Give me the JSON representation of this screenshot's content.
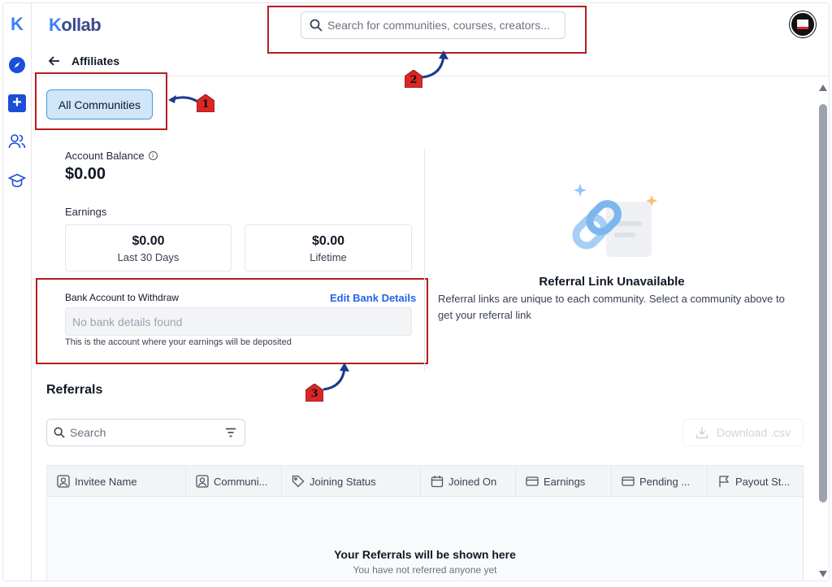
{
  "brand": {
    "logo_letter": "K",
    "name_prefix": "K",
    "name_rest": "ollab"
  },
  "search": {
    "placeholder": "Search for communities, courses, creators..."
  },
  "nav": {
    "back_title": "Affiliates"
  },
  "community_filter": {
    "label": "All Communities"
  },
  "annotations": {
    "one": "1",
    "two": "2",
    "three": "3"
  },
  "account": {
    "balance_label": "Account Balance",
    "info_glyph": "i",
    "balance_value": "$0.00",
    "earnings_label": "Earnings",
    "stats": [
      {
        "value": "$0.00",
        "label": "Last 30 Days"
      },
      {
        "value": "$0.00",
        "label": "Lifetime"
      }
    ]
  },
  "bank": {
    "label": "Bank Account to Withdraw",
    "edit_label": "Edit Bank Details",
    "placeholder": "No bank details found",
    "help": "This is the account where your earnings will be deposited"
  },
  "referral_link": {
    "title": "Referral Link Unavailable",
    "description": "Referral links are unique to each community. Select a community above to get your referral link"
  },
  "referrals": {
    "heading": "Referrals",
    "search_placeholder": "Search",
    "download_label": "Download .csv",
    "columns": [
      "Invitee Name",
      "Communi...",
      "Joining Status",
      "Joined On",
      "Earnings",
      "Pending ...",
      "Payout St..."
    ],
    "empty_title": "Your Referrals will be shown here",
    "empty_subtitle": "You have not referred anyone yet"
  },
  "colors": {
    "accent": "#2563eb",
    "annotation_red": "#b91c1c",
    "chip_bg": "#cfe6fb"
  }
}
